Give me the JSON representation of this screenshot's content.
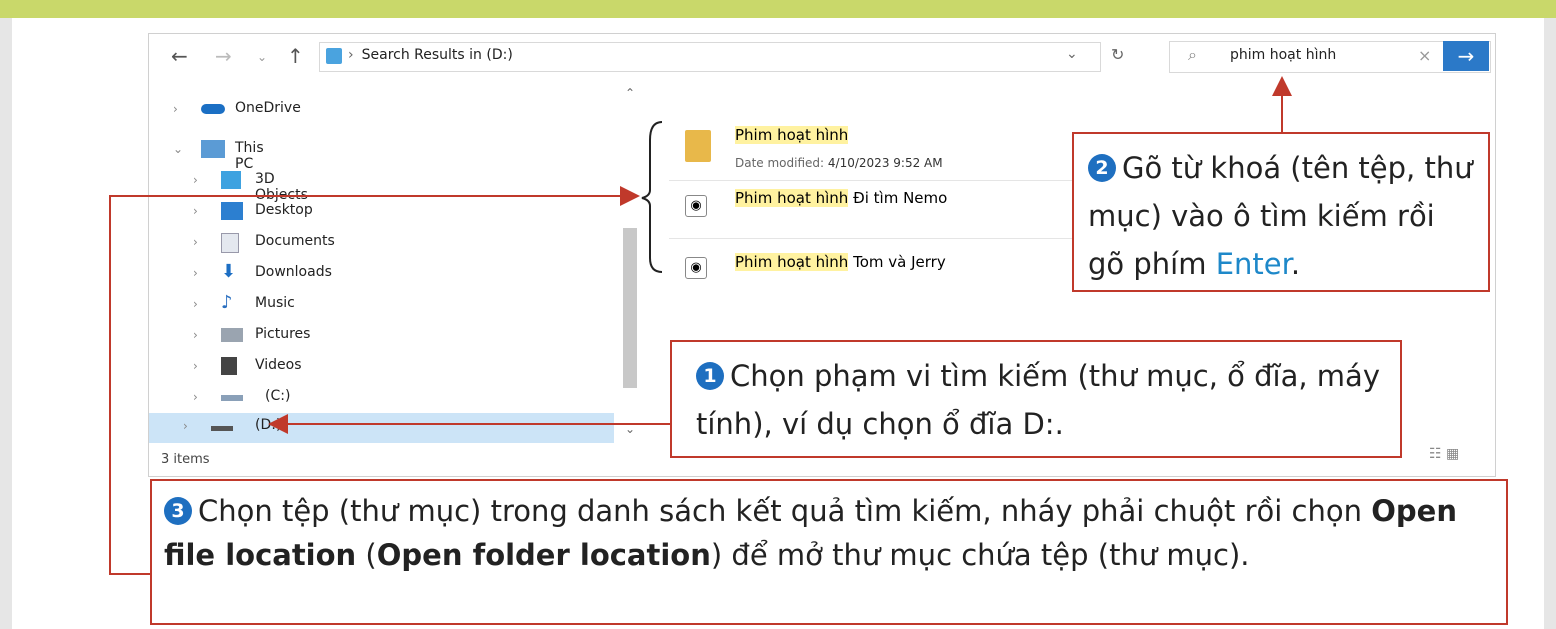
{
  "explorer": {
    "path": "Search Results in",
    "path_drive": "(D:)",
    "search_value": "phim hoạt hình",
    "sidebar": [
      "OneDrive",
      "This PC",
      "3D Objects",
      "Desktop",
      "Documents",
      "Downloads",
      "Music",
      "Pictures",
      "Videos",
      "(C:)",
      "(D:)"
    ],
    "files": [
      {
        "hl": "Phim hoạt hình",
        "rest": "",
        "meta_label": "Date modified:",
        "meta_value": "4/10/2023 9:52 AM"
      },
      {
        "hl": "Phim hoạt hình",
        "rest": " Đi tìm Nemo"
      },
      {
        "hl": "Phim hoạt hình",
        "rest": " Tom và Jerry"
      }
    ],
    "status": "3 items"
  },
  "callouts": {
    "c2_num": "2",
    "c2_text": "Gõ từ khoá (tên tệp, thư mục) vào ô tìm kiếm rồi gõ phím ",
    "c2_enter": "Enter",
    "c2_end": ".",
    "c1_num": "1",
    "c1_text": "Chọn phạm vi tìm kiếm (thư mục, ổ đĩa, máy tính), ví dụ chọn ổ đĩa D:.",
    "c3_num": "3",
    "c3_a": "Chọn tệp (thư mục) trong danh sách kết quả tìm kiếm, nháy phải chuột rồi chọn ",
    "c3_b1": "Open file location",
    "c3_c": " (",
    "c3_b2": "Open folder location",
    "c3_d": ") để mở thư mục chứa tệp (thư mục)."
  },
  "colors": {
    "accent": "#c0392b",
    "brand": "#1e6fc0",
    "highlight": "#fff2a0",
    "topbar": "#c9d86a"
  }
}
